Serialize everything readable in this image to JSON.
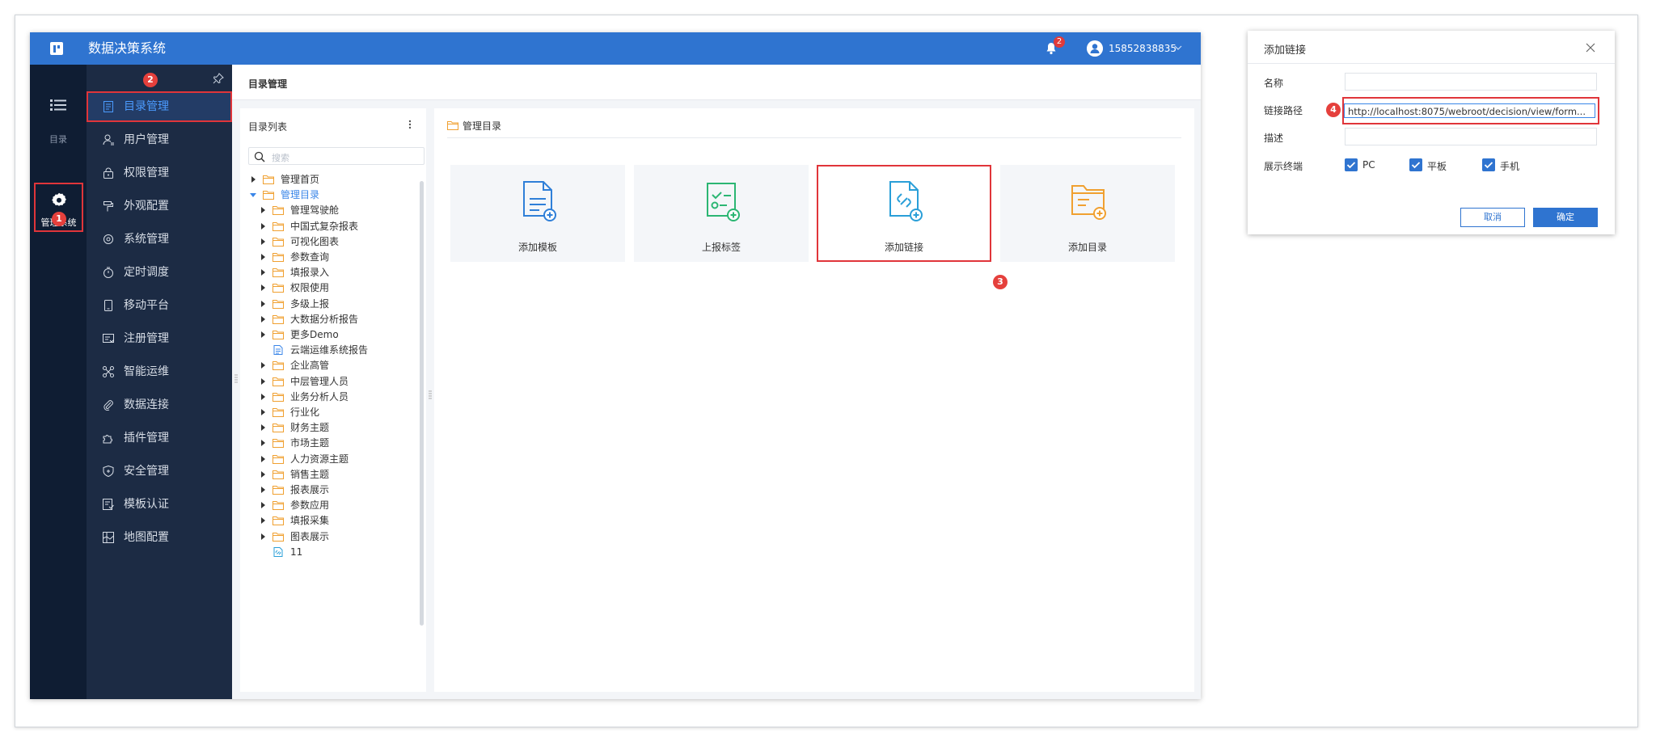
{
  "topbar": {
    "title": "数据决策系统",
    "notification_count": "2",
    "user_name": "15852838835"
  },
  "rail": {
    "directory_label": "目录",
    "admin_label": "管理系统"
  },
  "steps": [
    "1",
    "2",
    "3",
    "4"
  ],
  "menu": {
    "items": [
      {
        "label": "目录管理",
        "icon": "list-doc-icon"
      },
      {
        "label": "用户管理",
        "icon": "user-icon"
      },
      {
        "label": "权限管理",
        "icon": "lock-icon"
      },
      {
        "label": "外观配置",
        "icon": "paint-roller-icon"
      },
      {
        "label": "系统管理",
        "icon": "gear-icon"
      },
      {
        "label": "定时调度",
        "icon": "stopwatch-icon"
      },
      {
        "label": "移动平台",
        "icon": "tablet-icon"
      },
      {
        "label": "注册管理",
        "icon": "register-icon"
      },
      {
        "label": "智能运维",
        "icon": "network-icon"
      },
      {
        "label": "数据连接",
        "icon": "paperclip-icon"
      },
      {
        "label": "插件管理",
        "icon": "puzzle-icon"
      },
      {
        "label": "安全管理",
        "icon": "shield-icon"
      },
      {
        "label": "模板认证",
        "icon": "certificate-icon"
      },
      {
        "label": "地图配置",
        "icon": "map-icon"
      }
    ]
  },
  "content": {
    "header_title": "目录管理"
  },
  "tree": {
    "title": "目录列表",
    "search_placeholder": "搜索",
    "nodes": [
      {
        "label": "管理首页",
        "level": 0,
        "expanded": false,
        "type": "folder"
      },
      {
        "label": "管理目录",
        "level": 0,
        "expanded": true,
        "type": "folder"
      },
      {
        "label": "管理驾驶舱",
        "level": 1,
        "expanded": false,
        "type": "folder"
      },
      {
        "label": "中国式复杂报表",
        "level": 1,
        "expanded": false,
        "type": "folder"
      },
      {
        "label": "可视化图表",
        "level": 1,
        "expanded": false,
        "type": "folder"
      },
      {
        "label": "参数查询",
        "level": 1,
        "expanded": false,
        "type": "folder"
      },
      {
        "label": "填报录入",
        "level": 1,
        "expanded": false,
        "type": "folder"
      },
      {
        "label": "权限使用",
        "level": 1,
        "expanded": false,
        "type": "folder"
      },
      {
        "label": "多级上报",
        "level": 1,
        "expanded": false,
        "type": "folder"
      },
      {
        "label": "大数据分析报告",
        "level": 1,
        "expanded": false,
        "type": "folder"
      },
      {
        "label": "更多Demo",
        "level": 1,
        "expanded": false,
        "type": "folder"
      },
      {
        "label": "云端运维系统报告",
        "level": 1,
        "expanded": false,
        "type": "file"
      },
      {
        "label": "企业高管",
        "level": 1,
        "expanded": false,
        "type": "folder"
      },
      {
        "label": "中层管理人员",
        "level": 1,
        "expanded": false,
        "type": "folder"
      },
      {
        "label": "业务分析人员",
        "level": 1,
        "expanded": false,
        "type": "folder"
      },
      {
        "label": "行业化",
        "level": 1,
        "expanded": false,
        "type": "folder"
      },
      {
        "label": "财务主题",
        "level": 1,
        "expanded": false,
        "type": "folder"
      },
      {
        "label": "市场主题",
        "level": 1,
        "expanded": false,
        "type": "folder"
      },
      {
        "label": "人力资源主题",
        "level": 1,
        "expanded": false,
        "type": "folder"
      },
      {
        "label": "销售主题",
        "level": 1,
        "expanded": false,
        "type": "folder"
      },
      {
        "label": "报表展示",
        "level": 1,
        "expanded": false,
        "type": "folder"
      },
      {
        "label": "参数应用",
        "level": 1,
        "expanded": false,
        "type": "folder"
      },
      {
        "label": "填报采集",
        "level": 1,
        "expanded": false,
        "type": "folder"
      },
      {
        "label": "图表展示",
        "level": 1,
        "expanded": false,
        "type": "folder"
      },
      {
        "label": "11",
        "level": 1,
        "expanded": false,
        "type": "link"
      }
    ]
  },
  "main": {
    "breadcrumb": "管理目录",
    "cards": [
      {
        "label": "添加模板",
        "icon": "add-template-icon",
        "color": "#2f7fd8"
      },
      {
        "label": "上报标签",
        "icon": "report-tag-icon",
        "color": "#2bb673"
      },
      {
        "label": "添加链接",
        "icon": "add-link-icon",
        "color": "#2a9fd8"
      },
      {
        "label": "添加目录",
        "icon": "add-folder-icon",
        "color": "#f0a030"
      }
    ]
  },
  "dialog": {
    "title": "添加链接",
    "name_label": "名称",
    "name_value": "",
    "path_label": "链接路径",
    "path_value": "http://localhost:8075/webroot/decision/view/form...",
    "desc_label": "描述",
    "desc_value": "",
    "terminal_label": "展示终端",
    "terminals": [
      {
        "label": "PC",
        "checked": true
      },
      {
        "label": "平板",
        "checked": true
      },
      {
        "label": "手机",
        "checked": true
      }
    ],
    "cancel_label": "取消",
    "ok_label": "确定"
  },
  "colors": {
    "brand_blue": "#2f74d0",
    "rail_bg": "#0f1d33",
    "menu_bg": "#1c2b44",
    "highlight_red": "#e0353a"
  }
}
